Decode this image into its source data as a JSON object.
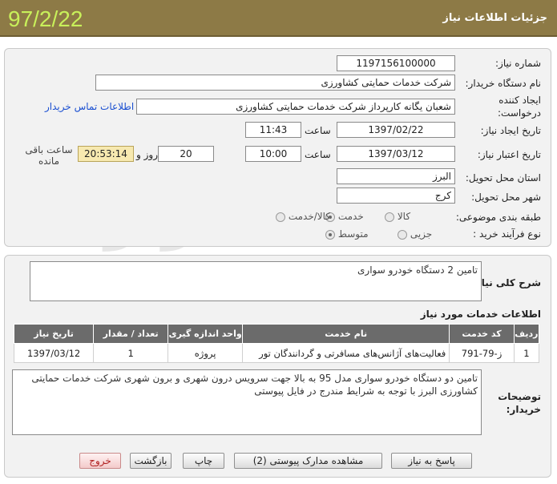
{
  "header": {
    "title": "جزئیات اطلاعات نیاز",
    "date": "97/2/22"
  },
  "form": {
    "need_number_label": "شماره نیاز:",
    "need_number": "1197156100000",
    "buyer_label": "نام دستگاه خریدار:",
    "buyer": "شرکت خدمات حمایتی کشاورزی",
    "creator_label_1": "ایجاد کننده",
    "creator_label_2": "درخواست:",
    "creator": "شعبان  یگانه کارپرداز شرکت خدمات حمایتی کشاورزی",
    "contact_link": "اطلاعات تماس خریدار",
    "created_date_label": "تاریخ ایجاد نیاز:",
    "created_date": "1397/02/22",
    "time_label": "ساعت",
    "created_time": "11:43",
    "valid_date_label": "تاریخ اعتبار نیاز:",
    "valid_date": "1397/03/12",
    "valid_time": "10:00",
    "days": "20",
    "days_label": "روز و",
    "remaining": "20:53:14",
    "remaining_label": "ساعت باقی مانده",
    "province_label": "استان محل تحویل:",
    "province": "البرز",
    "city_label": "شهر محل تحویل:",
    "city": "کرج",
    "category_label": "طبقه بندی موضوعی:",
    "category_options": [
      "کالا",
      "خدمت",
      "کالا/خدمت"
    ],
    "category_selected": "خدمت",
    "process_label": "نوع فرآیند خرید :",
    "process_options": [
      "جزیی",
      "متوسط"
    ],
    "process_selected": "متوسط"
  },
  "description": {
    "label": "شرح کلی نیاز:",
    "text": "تامین 2 دستگاه خودرو سواری"
  },
  "services": {
    "title": "اطلاعات خدمات مورد نیاز",
    "columns": [
      "ردیف",
      "کد خدمت",
      "نام خدمت",
      "واحد اندازه گیری",
      "تعداد / مقدار",
      "تاریخ نیاز"
    ],
    "rows": [
      [
        "1",
        "ز-79-791",
        "فعالیت‌های آژانس‌های مسافرتی و گردانندگان تور",
        "پروژه",
        "1",
        "1397/03/12"
      ]
    ]
  },
  "buyer_notes": {
    "label_1": "توضیحات",
    "label_2": "خریدار:",
    "text": "تامین دو دستگاه خودرو سواری مدل 95 به بالا جهت سرویس درون شهری و برون شهری شرکت خدمات حمایتی کشاورزی البرز با توجه به شرایط مندرج در فایل پیوستی"
  },
  "buttons": {
    "reply": "پاسخ به نیاز",
    "attachments": "مشاهده مدارک پیوستی (2)",
    "print": "چاپ",
    "back": "بازگشت",
    "exit": "خروج"
  },
  "watermark": {
    "main": "هزاره",
    "sub": "ارتباط گستران"
  },
  "colors": {
    "header": "#8d7a46",
    "date": "#c8f05a",
    "table_header": "#6b6b6b",
    "link": "#1a4fd1"
  }
}
